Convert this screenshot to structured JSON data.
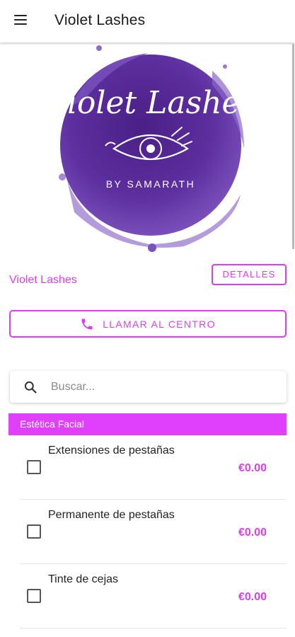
{
  "appbar": {
    "title": "Violet Lashes",
    "menu_icon": "hamburger-menu-icon"
  },
  "logo": {
    "script_text": "Violet Lashes",
    "subtitle": "BY SAMARATH"
  },
  "salon": {
    "name": "Violet Lashes",
    "details_label": "DETALLES"
  },
  "call": {
    "label": "LLAMAR AL CENTRO",
    "icon": "phone-icon"
  },
  "search": {
    "placeholder": "Buscar...",
    "value": "",
    "icon": "search-icon"
  },
  "category": {
    "label": "Estética Facial"
  },
  "services": [
    {
      "name": "Extensiones de pestañas",
      "price": "€0.00",
      "checked": false
    },
    {
      "name": "Permanente de pestañas",
      "price": "€0.00",
      "checked": false
    },
    {
      "name": "Tinte de cejas",
      "price": "€0.00",
      "checked": false
    }
  ],
  "colors": {
    "accent": "#d93ff0",
    "category_bg": "#e040fb",
    "logo_purple": "#5c2f9c"
  }
}
